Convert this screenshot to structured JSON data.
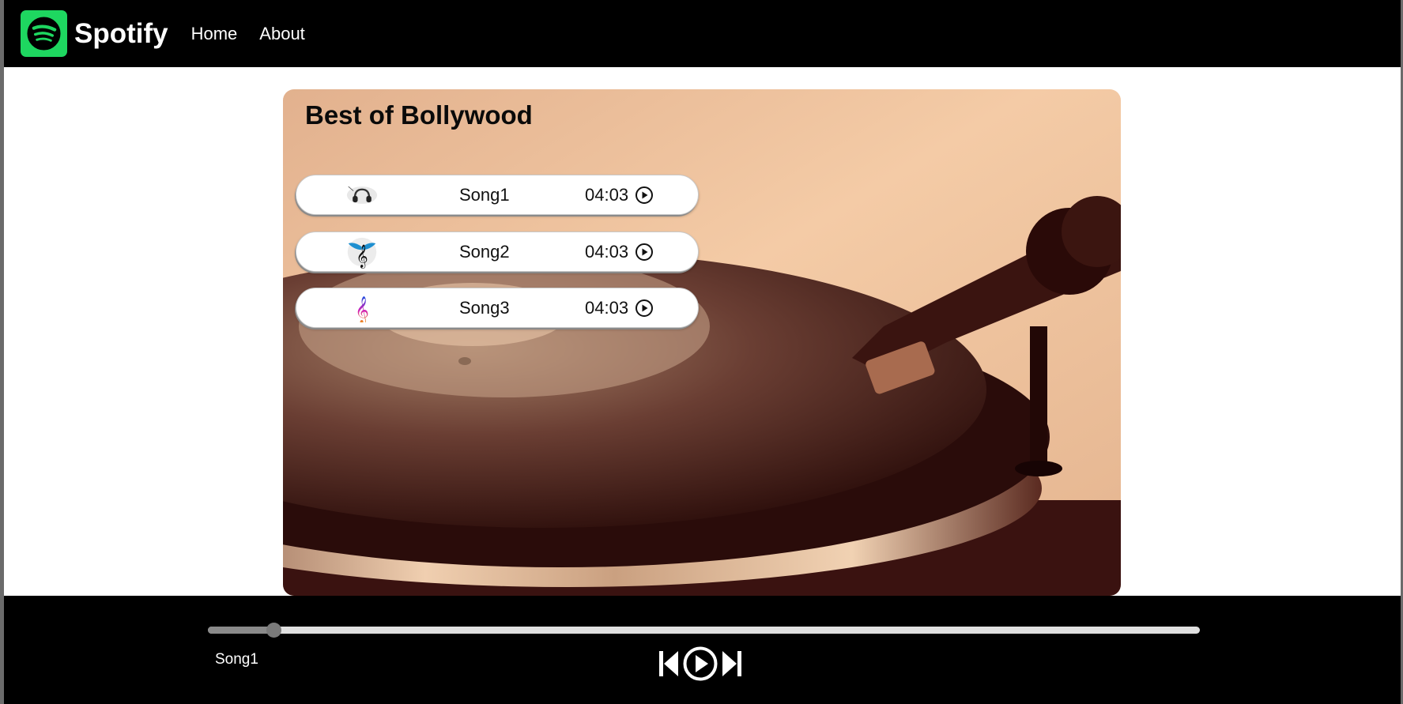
{
  "navbar": {
    "logo_icon": "spotify-logo-icon",
    "brand": "Spotify",
    "links": [
      {
        "label": "Home"
      },
      {
        "label": "About"
      }
    ]
  },
  "playlist": {
    "title": "Best of Bollywood",
    "background": "vinyl-turntable-photo",
    "songs": [
      {
        "name": "Song1",
        "duration": "04:03",
        "thumb_icon": "headphones-thumbnail"
      },
      {
        "name": "Song2",
        "duration": "04:03",
        "thumb_icon": "winged-treble-clef-thumbnail"
      },
      {
        "name": "Song3",
        "duration": "04:03",
        "thumb_icon": "colorful-treble-clef-thumbnail"
      }
    ]
  },
  "player": {
    "progress": 0.067,
    "current_song": "Song1",
    "controls": [
      "previous-icon",
      "play-icon",
      "next-icon"
    ]
  },
  "colors": {
    "brand_green": "#1ed760",
    "bar_background": "#000000",
    "track": "#e0e0e0",
    "track_fill": "#8a8a8a"
  }
}
